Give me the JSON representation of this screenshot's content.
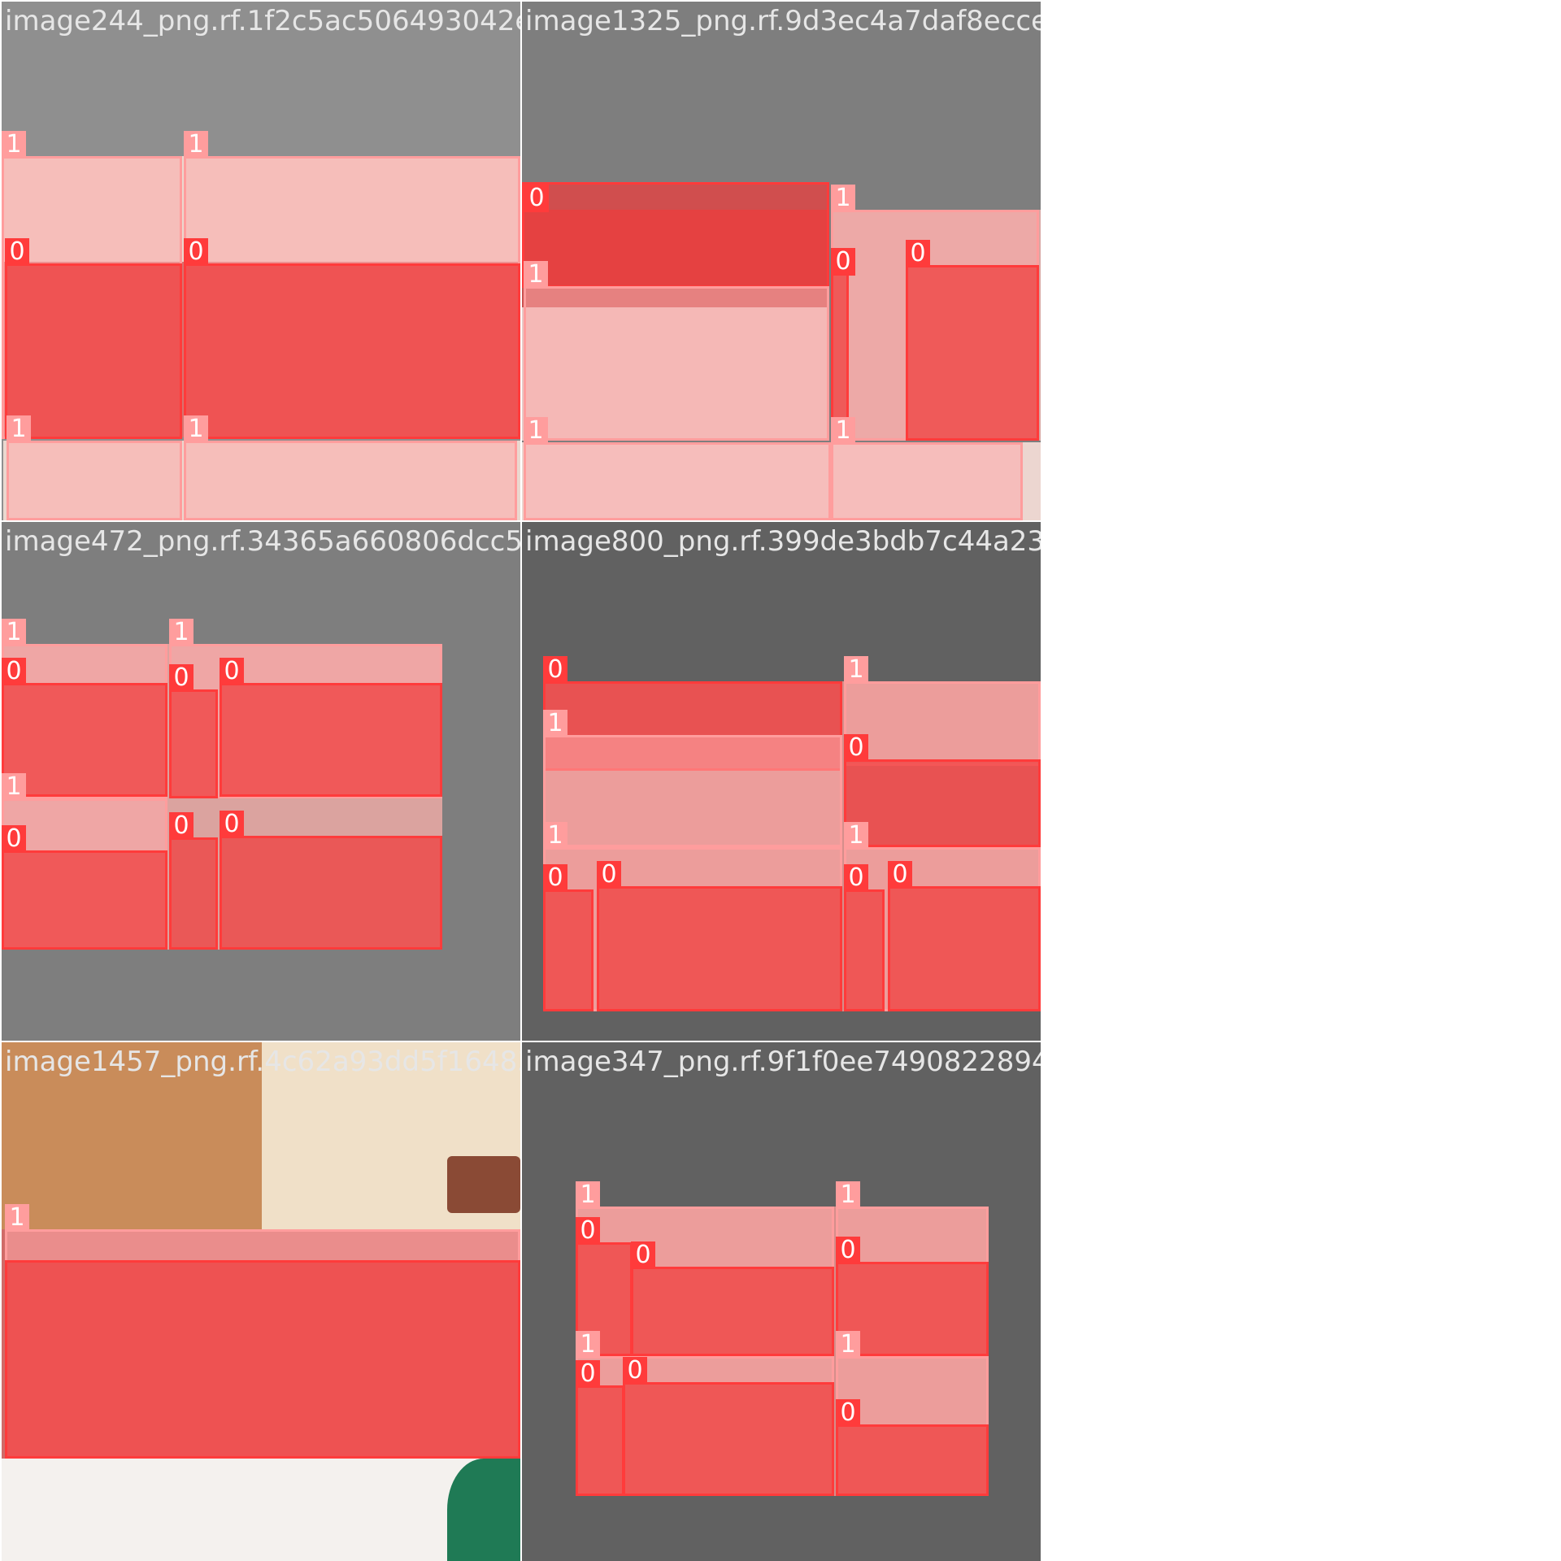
{
  "mosaic": {
    "classes": [
      "0",
      "1"
    ],
    "colors": {
      "class0": "#ff3b3b",
      "class1": "#ff9d9d",
      "tile_bg_a": "#8f8f8f",
      "tile_bg_b": "#7e7e7e",
      "tile_bg_c": "#616161",
      "floor": "#d8726f",
      "wall": "#e9d9cf"
    },
    "tiles": [
      {
        "filename": "image244_png.rf.1f2c5ac506493042ef9014f5"
      },
      {
        "filename": "image1325_png.rf.9d3ec4a7daf8ecceb3749ef"
      },
      {
        "filename": "image472_png.rf.34365a660806dcc5ac222a90"
      },
      {
        "filename": "image800_png.rf.399de3bdb7c44a23220009f6"
      },
      {
        "filename": "image1457_png.rf.4c62a93dd5f16483a9b731"
      },
      {
        "filename": "image347_png.rf.9f1f0ee74908228941166e4f"
      }
    ]
  }
}
